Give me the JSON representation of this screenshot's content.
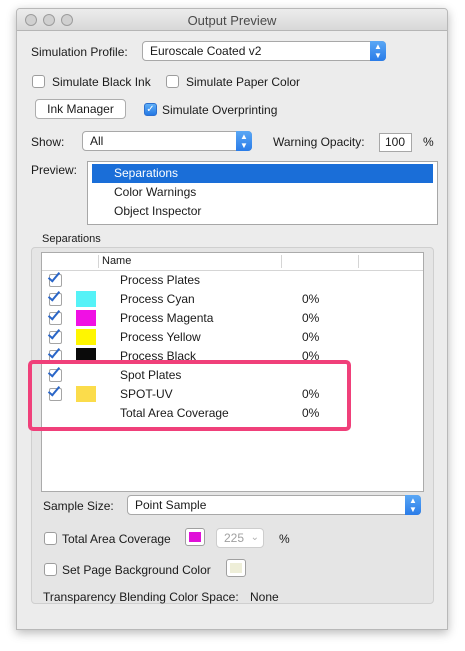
{
  "window": {
    "title": "Output Preview"
  },
  "simulation_profile": {
    "label": "Simulation Profile:",
    "value": "Euroscale Coated v2"
  },
  "simulate_black_ink": {
    "label": "Simulate Black Ink",
    "checked": false
  },
  "simulate_paper_color": {
    "label": "Simulate Paper Color",
    "checked": false
  },
  "ink_manager": {
    "label": "Ink Manager"
  },
  "simulate_overprinting": {
    "label": "Simulate Overprinting",
    "checked": true
  },
  "show": {
    "label": "Show:",
    "value": "All"
  },
  "warning_opacity": {
    "label": "Warning Opacity:",
    "value": "100",
    "unit": "%"
  },
  "preview": {
    "label": "Preview:",
    "items": [
      "Separations",
      "Color Warnings",
      "Object Inspector"
    ],
    "selected": "Separations"
  },
  "separations": {
    "group_label": "Separations",
    "column_name": "Name",
    "rows": [
      {
        "name": "Process Plates",
        "checked": true,
        "color": null,
        "pct": ""
      },
      {
        "name": "Process Cyan",
        "checked": true,
        "color": "#55f2f7",
        "pct": "0%"
      },
      {
        "name": "Process Magenta",
        "checked": true,
        "color": "#f010e4",
        "pct": "0%"
      },
      {
        "name": "Process Yellow",
        "checked": true,
        "color": "#fff600",
        "pct": "0%"
      },
      {
        "name": "Process Black",
        "checked": true,
        "color": "#0a0a0a",
        "pct": "0%"
      },
      {
        "name": "Spot Plates",
        "checked": true,
        "color": null,
        "pct": ""
      },
      {
        "name": "SPOT-UV",
        "checked": true,
        "color": "#fbdc4b",
        "pct": "0%"
      },
      {
        "name": "Total Area Coverage",
        "checked": false,
        "color": null,
        "pct": "0%"
      }
    ]
  },
  "sample_size": {
    "label": "Sample Size:",
    "value": "Point Sample"
  },
  "total_area_coverage": {
    "label": "Total Area Coverage",
    "checked": false,
    "color": "#e010d8",
    "value": "225",
    "unit": "%"
  },
  "set_page_background": {
    "label": "Set Page Background Color",
    "checked": false,
    "color": "#eeeed8"
  },
  "transparency_blending": {
    "label": "Transparency Blending Color Space:",
    "value": "None"
  }
}
